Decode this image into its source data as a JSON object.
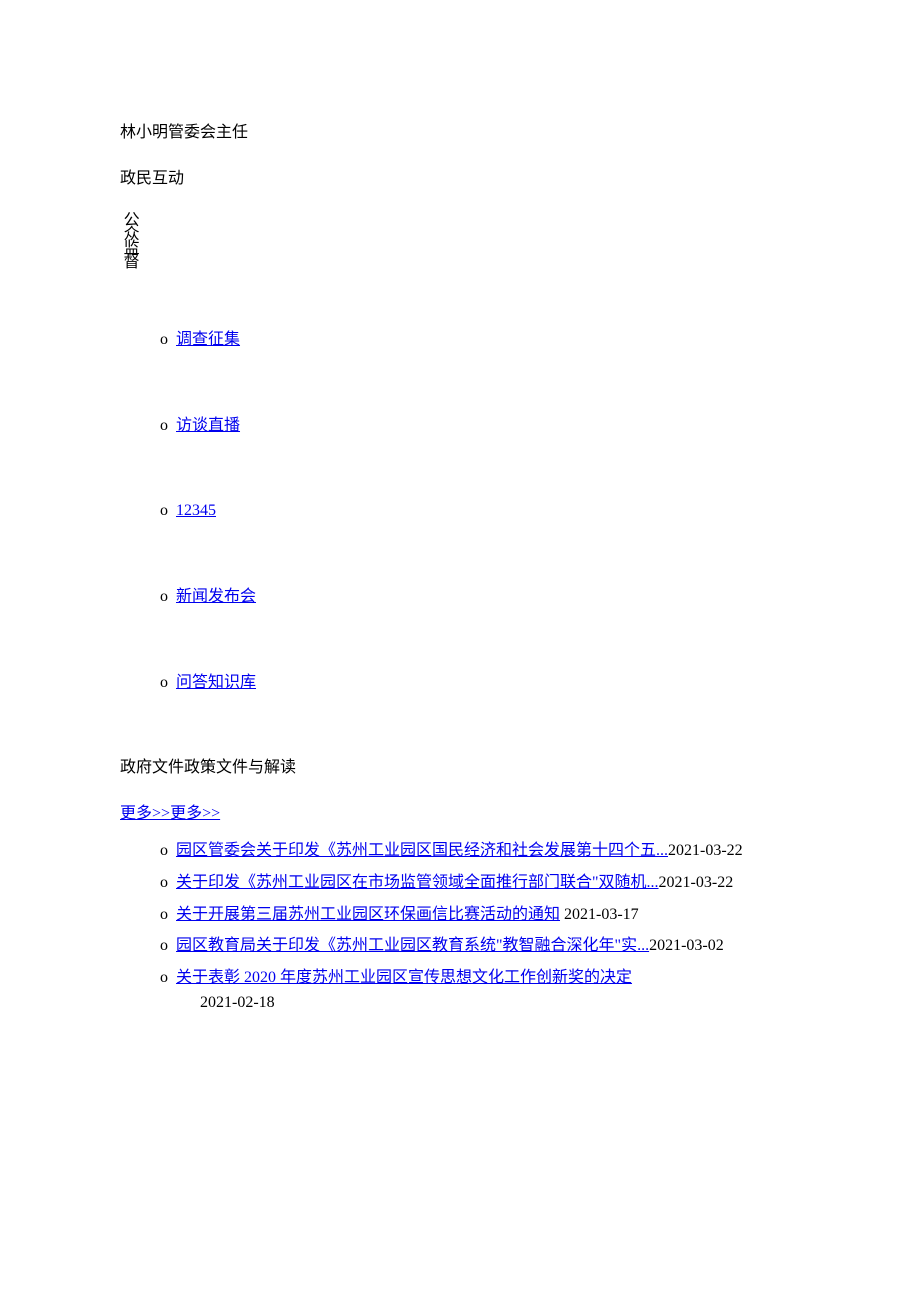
{
  "header": {
    "name": "林小明",
    "position": "管委会主任"
  },
  "interaction": {
    "title": "政民互动",
    "vertical_label": "公众监督"
  },
  "nav": {
    "items": [
      {
        "bullet": "o",
        "label": "调查征集"
      },
      {
        "bullet": "o",
        "label": "访谈直播"
      },
      {
        "bullet": "o",
        "label": "12345"
      },
      {
        "bullet": "o",
        "label": "新闻发布会"
      },
      {
        "bullet": "o",
        "label": "问答知识库"
      }
    ]
  },
  "tabs": {
    "tab1": "政府文件",
    "tab2": "政策文件与解读"
  },
  "more": {
    "label1": "更多>>",
    "label2": "更多>>"
  },
  "documents": {
    "items": [
      {
        "bullet": "o",
        "title": "园区管委会关于印发《苏州工业园区国民经济和社会发展第十四个五...",
        "date": "2021-03-22",
        "date_inline": true
      },
      {
        "bullet": "o",
        "title": "关于印发《苏州工业园区在市场监管领域全面推行部门联合\"双随机...",
        "date": "2021-03-22",
        "date_inline": true
      },
      {
        "bullet": "o",
        "title": "关于开展第三届苏州工业园区环保画信比赛活动的通知",
        "date": "2021-03-17",
        "date_inline": true
      },
      {
        "bullet": "o",
        "title": "园区教育局关于印发《苏州工业园区教育系统\"教智融合深化年\"实...",
        "date": "2021-03-02",
        "date_inline": true
      },
      {
        "bullet": "o",
        "title": "关于表彰 2020 年度苏州工业园区宣传思想文化工作创新奖的决定",
        "date": "2021-02-18",
        "date_inline": false
      }
    ]
  }
}
